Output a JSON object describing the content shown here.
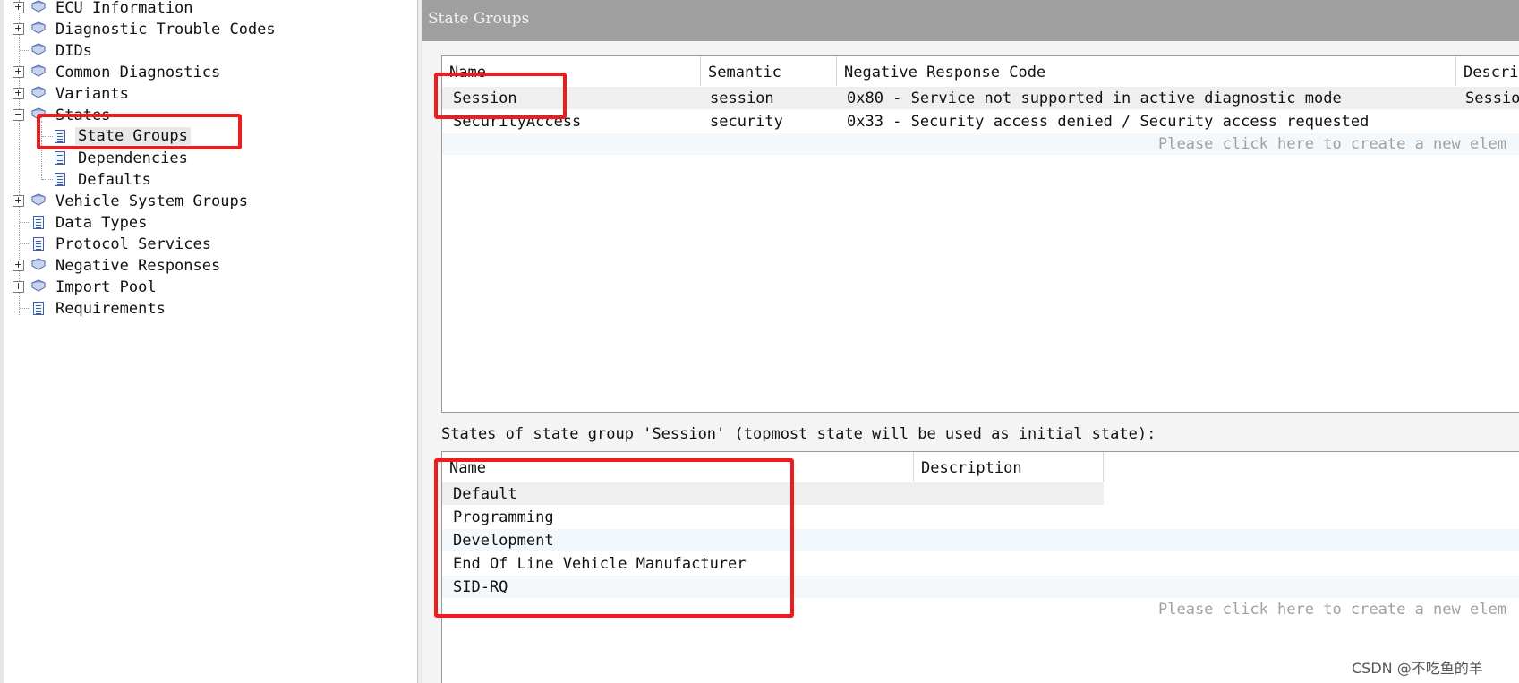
{
  "tree": {
    "items": [
      {
        "label": "ECU Information",
        "expander": "+",
        "icon": "book-icon"
      },
      {
        "label": "Diagnostic Trouble Codes",
        "expander": "+",
        "icon": "book-icon"
      },
      {
        "label": "DIDs",
        "expander": "",
        "icon": "book-icon"
      },
      {
        "label": "Common Diagnostics",
        "expander": "+",
        "icon": "book-icon"
      },
      {
        "label": "Variants",
        "expander": "+",
        "icon": "book-icon"
      },
      {
        "label": "States",
        "expander": "−",
        "icon": "book-icon"
      },
      {
        "label": "State Groups",
        "expander": "",
        "icon": "page-icon"
      },
      {
        "label": "Dependencies",
        "expander": "",
        "icon": "page-icon"
      },
      {
        "label": "Defaults",
        "expander": "",
        "icon": "page-icon"
      },
      {
        "label": "Vehicle System Groups",
        "expander": "+",
        "icon": "book-icon"
      },
      {
        "label": "Data Types",
        "expander": "",
        "icon": "page-icon"
      },
      {
        "label": "Protocol Services",
        "expander": "",
        "icon": "page-icon"
      },
      {
        "label": "Negative Responses",
        "expander": "+",
        "icon": "book-icon"
      },
      {
        "label": "Import Pool",
        "expander": "+",
        "icon": "book-icon"
      },
      {
        "label": "Requirements",
        "expander": "",
        "icon": "page-icon"
      }
    ]
  },
  "panel": {
    "title": "State Groups"
  },
  "groups_table": {
    "columns": [
      "Name",
      "Semantic",
      "Negative Response Code",
      "Descri"
    ],
    "rows": [
      {
        "name": "Session",
        "semantic": "session",
        "nrc": "0x80 - Service not supported in active diagnostic mode",
        "desc": "Sessio"
      },
      {
        "name": "SecurityAccess",
        "semantic": "security",
        "nrc": "0x33 - Security access denied / Security access requested",
        "desc": ""
      }
    ],
    "create_hint": "Please click here to create a new elem"
  },
  "states": {
    "caption": "States of state group 'Session' (topmost state will be used as initial state):",
    "columns": [
      "Name",
      "Description"
    ],
    "rows": [
      {
        "name": "Default",
        "desc": ""
      },
      {
        "name": "Programming",
        "desc": ""
      },
      {
        "name": "Development",
        "desc": ""
      },
      {
        "name": "End Of Line Vehicle Manufacturer",
        "desc": ""
      },
      {
        "name": "SID-RQ",
        "desc": ""
      }
    ],
    "create_hint": "Please click here to create a new elem"
  },
  "watermark": "CSDN @不吃鱼的羊",
  "colors": {
    "highlight_box": "#ee1c1c",
    "header_bg": "#9f9f9f",
    "selected_row": "#efefef",
    "alt_row": "#f3f8fc"
  }
}
